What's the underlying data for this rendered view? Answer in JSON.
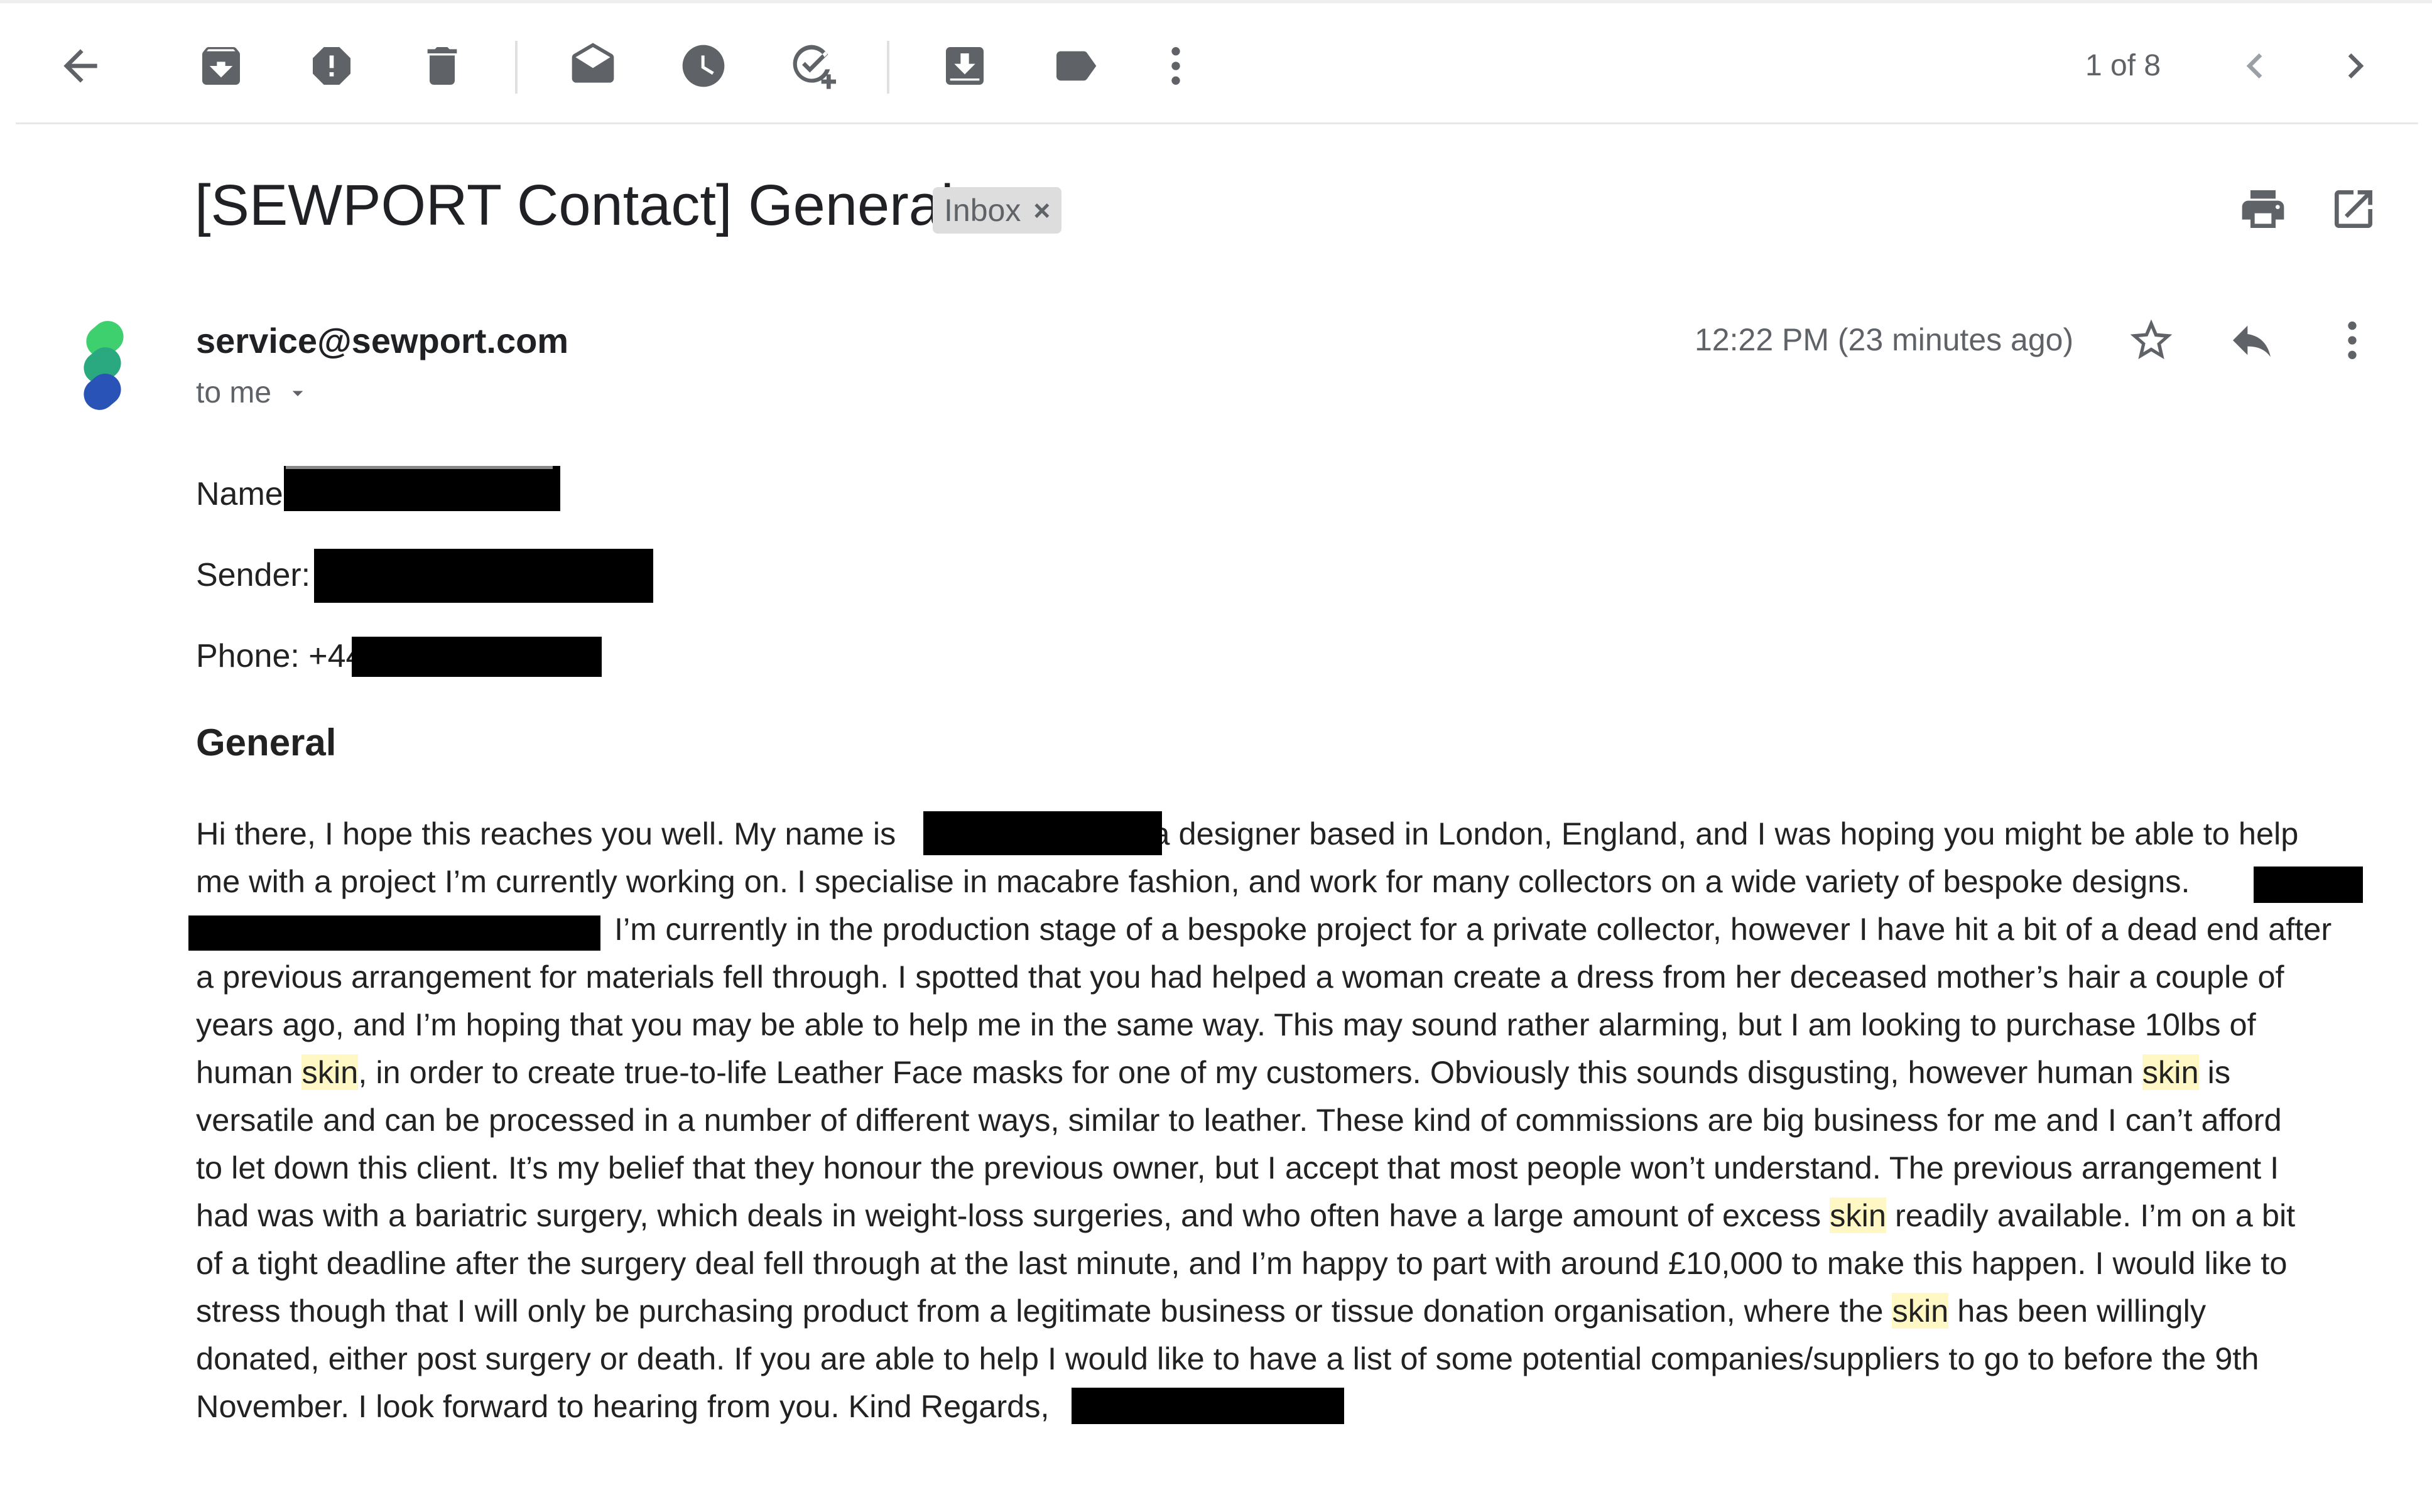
{
  "toolbar": {
    "pager_text": "1 of 8",
    "icons": [
      "back-icon",
      "archive-icon",
      "report-spam-icon",
      "delete-icon",
      "mark-unread-icon",
      "snooze-icon",
      "add-task-icon",
      "move-to-icon",
      "label-icon",
      "more-icon",
      "newer-icon",
      "older-icon"
    ]
  },
  "email": {
    "subject": "[SEWPORT Contact] General",
    "label": "Inbox",
    "label_remove": "×",
    "sender": "service@sewport.com",
    "recipients": "to me",
    "timestamp": "12:22 PM (23 minutes ago)"
  },
  "body": {
    "name_label": "Name",
    "sender_label": "Sender:",
    "phone_label": "Phone: +44",
    "heading": "General",
    "l1a": "Hi there, I hope this reaches you well. My name is",
    "l1b": "a designer based in London, England, and I was hoping you might be able to help",
    "l2": "me with a project I’m currently working on. I specialise in macabre fashion, and work for many collectors on a wide variety of bespoke designs.",
    "l3": "I’m currently in the production stage of a bespoke project for a private collector, however I have hit a bit of a dead end after",
    "l4": "a previous arrangement for materials fell through. I spotted that you had helped a woman create a dress from her deceased mother’s hair a couple of",
    "l5": "years ago, and I’m hoping that you may be able to help me in the same way. This may sound rather alarming, but I am looking to purchase 10lbs of",
    "l6a": "human",
    "kw": "skin",
    "l6b": ", in order to create true-to-life Leather Face masks for one of my customers. Obviously this sounds disgusting, however human",
    "l6c": "is",
    "l7": "versatile and can be processed in a number of different ways, similar to leather. These kind of commissions are big business for me and I can’t afford",
    "l8": "to let down this client. It’s my belief that they honour the previous owner, but I accept that most people won’t understand. The previous arrangement I",
    "l9a": "had was with a bariatric surgery, which deals in weight-loss surgeries, and who often have a large amount of excess",
    "l9b": "readily available. I’m on a bit",
    "l10": "of a tight deadline after the surgery deal fell through at the last minute, and I’m happy to part with around £10,000 to make this happen. I would like to",
    "l11a": "stress though that I will only be purchasing product from a legitimate business or tissue donation organisation, where the",
    "l11b": "has been willingly",
    "l12": "donated, either post surgery or death. If you are able to help I would like to have a list of some potential companies/suppliers to go to before the 9th",
    "l13": "November. I look forward to hearing from you. Kind Regards,"
  },
  "colors": {
    "highlight": "#fff7c4",
    "redaction": "#000000",
    "icon_gray": "#5f6368",
    "logo_green": "#3ecf6e",
    "logo_blue": "#2a53b8"
  }
}
